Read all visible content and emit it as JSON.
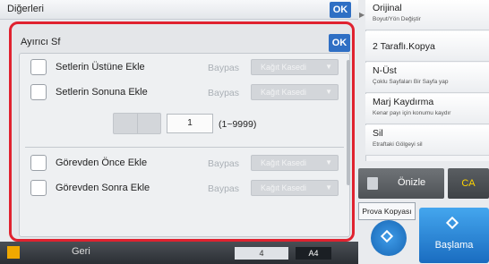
{
  "header": {
    "title": "Diğerleri",
    "ok_label": "OK"
  },
  "right_panel": {
    "items": [
      {
        "label": "Orijinal",
        "sub": "Boyut/Yön Değiştir"
      },
      {
        "label": "2 Taraflı.Kopya",
        "sub": ""
      },
      {
        "label": "N-Üst",
        "sub": "Çoklu Sayfaları Bir Sayfa yap"
      },
      {
        "label": "Marj Kaydırma",
        "sub": "Kenar payı için konumu kaydır"
      },
      {
        "label": "Sil",
        "sub": "Etraftaki Gölgeyi sil"
      }
    ],
    "preview_label": "Önizle",
    "ca_label": "CA",
    "proof_tab_label": "Prova Kopyası",
    "start_label": "Başlama"
  },
  "bottom_bar": {
    "back_label": "Geri",
    "field_value": "4",
    "paper_label": "A4"
  },
  "dialog": {
    "title": "Ayırıcı Sf",
    "ok_label": "OK",
    "rows": [
      {
        "label": "Setlerin Üstüne Ekle",
        "bypass": "Baypas",
        "tray": "Kağıt Kasedi"
      },
      {
        "label": "Setlerin Sonuna Ekle",
        "bypass": "Baypas",
        "tray": "Kağıt Kasedi"
      },
      {
        "label": "Görevden Önce Ekle",
        "bypass": "Baypas",
        "tray": "Kağıt Kasedi"
      },
      {
        "label": "Görevden Sonra Ekle",
        "bypass": "Baypas",
        "tray": "Kağıt Kasedi"
      }
    ],
    "count": {
      "value": "1",
      "range": "(1~9999)"
    }
  },
  "colors": {
    "accent": "#2f6fc4",
    "highlight_border": "#e0222f",
    "ca_text": "#ffd400"
  }
}
